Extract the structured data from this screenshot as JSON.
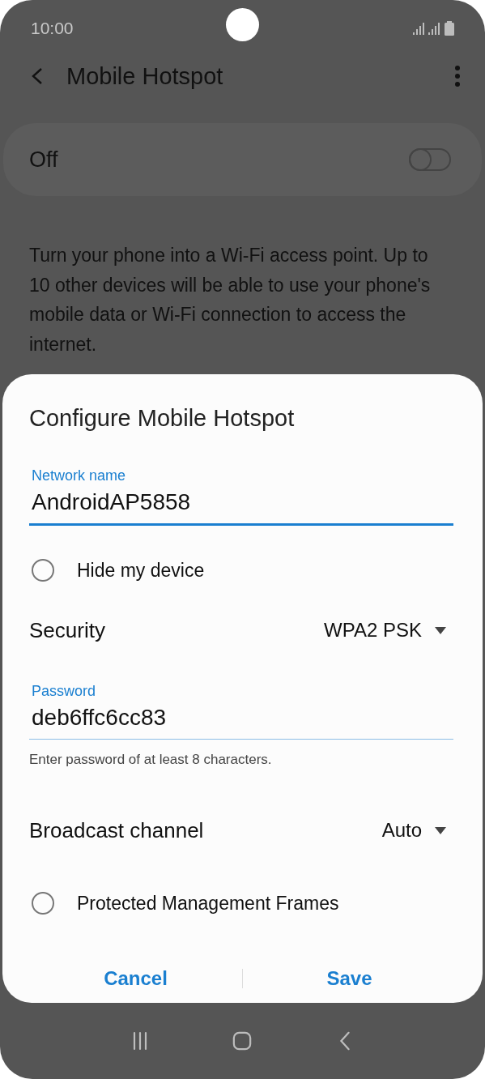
{
  "status_bar": {
    "time": "10:00"
  },
  "app_bar": {
    "title": "Mobile Hotspot"
  },
  "master_switch": {
    "label": "Off",
    "on": false
  },
  "description": "Turn your phone into a Wi-Fi access point. Up to 10 other devices will be able to use your phone's mobile data or Wi-Fi connection to access the internet.",
  "dialog": {
    "title": "Configure Mobile Hotspot",
    "rows": [
      {
        "kind": "text_field",
        "label": "Network name",
        "value": "AndroidAP5858",
        "focused": true
      },
      {
        "kind": "checkbox",
        "label": "Hide my device",
        "checked": false
      },
      {
        "kind": "dropdown",
        "label": "Security",
        "value": "WPA2 PSK"
      },
      {
        "kind": "text_field",
        "label": "Password",
        "value": "deb6ffc6cc83",
        "focused": false,
        "helper": "Enter password of at least 8 characters."
      },
      {
        "kind": "dropdown",
        "label": "Broadcast channel",
        "value": "Auto"
      },
      {
        "kind": "checkbox",
        "label": "Protected Management Frames",
        "checked": false
      }
    ],
    "buttons": [
      "Cancel",
      "Save"
    ]
  }
}
